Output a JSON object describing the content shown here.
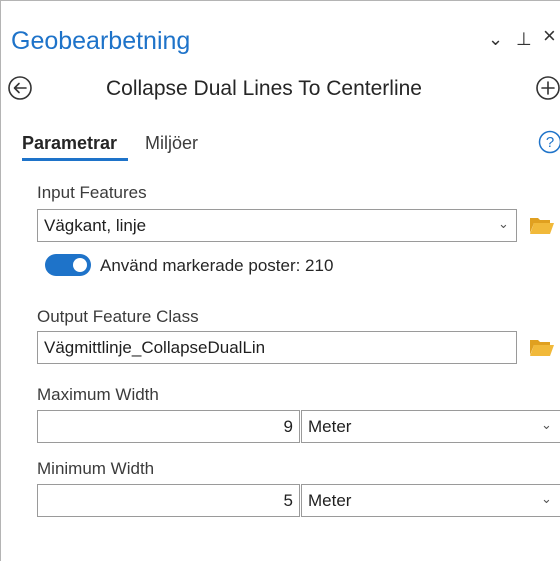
{
  "pane": {
    "title": "Geobearbetning",
    "chevron_glyph": "⌄",
    "pin_glyph": "⊥",
    "close_glyph": "×"
  },
  "tool": {
    "name": "Collapse Dual Lines To Centerline",
    "back_icon": "back-circle-arrow",
    "add_icon": "add-circle-plus"
  },
  "tabs": {
    "parameters": "Parametrar",
    "environments": "Miljöer",
    "help_glyph": "?"
  },
  "params": {
    "input_features": {
      "label": "Input Features",
      "value": "Vägkant, linje"
    },
    "use_selected": {
      "label": "Använd markerade poster: 210",
      "on": true
    },
    "output_feature_class": {
      "label": "Output Feature Class",
      "value": "Vägmittlinje_CollapseDualLin"
    },
    "maximum_width": {
      "label": "Maximum Width",
      "value": "9",
      "unit": "Meter"
    },
    "minimum_width": {
      "label": "Minimum Width",
      "value": "5",
      "unit": "Meter"
    }
  },
  "colors": {
    "accent": "#1e73c9",
    "folder": "#f1b93a"
  }
}
